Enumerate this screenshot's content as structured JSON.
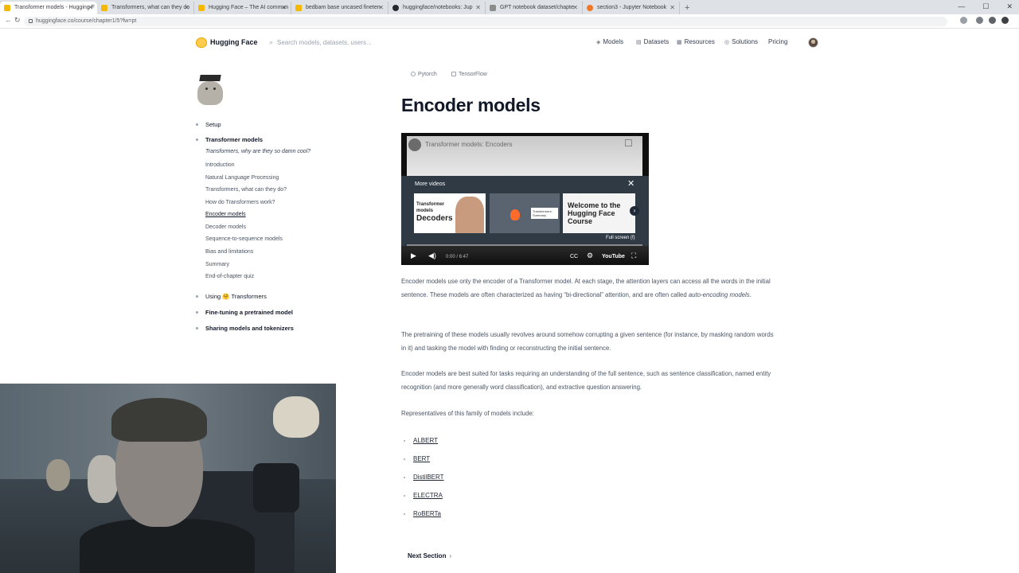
{
  "browser": {
    "tabs": [
      {
        "label": "Transformer models - Hugging F",
        "active": true
      },
      {
        "label": "Transformers, what can they do"
      },
      {
        "label": "Hugging Face – The AI commun"
      },
      {
        "label": "bedbam base uncased fineten"
      },
      {
        "label": "huggingface/notebooks: Jup"
      },
      {
        "label": "GPT notebook dataset/chapte"
      },
      {
        "label": "section3 - Jupyter Notebook"
      }
    ],
    "new_tab": "+",
    "url": "huggingface.co/course/chapter1/5?fw=pt"
  },
  "header": {
    "brand": "Hugging Face",
    "search_placeholder": "Search models, datasets, users...",
    "nav": [
      "Models",
      "Datasets",
      "Resources",
      "Solutions",
      "Pricing"
    ]
  },
  "sidebar": {
    "sections": [
      {
        "label": "Setup"
      },
      {
        "label": "Transformer models"
      },
      {
        "label": "Using 🤗 Transformers"
      },
      {
        "label": "Fine-tuning a pretrained model"
      },
      {
        "label": "Sharing models and tokenizers"
      }
    ],
    "items": [
      "Transformers, why are they so damn cool?",
      "Introduction",
      "Natural Language Processing",
      "Transformers, what can they do?",
      "How do Transformers work?",
      "Encoder models",
      "Decoder models",
      "Sequence-to-sequence models",
      "Bias and limitations",
      "Summary",
      "End-of-chapter quiz"
    ]
  },
  "main": {
    "framework_tabs": [
      "Pytorch",
      "TensorFlow"
    ],
    "title": "Encoder models",
    "video": {
      "title": "Transformer models: Encoders",
      "more_videos": "More videos",
      "thumb1_small": "Transformer models",
      "thumb1_big": "Decoders",
      "thumb2_card": "Transformers: Summary",
      "thumb3_line1": "Welcome to the",
      "thumb3_line2": "Hugging Face",
      "thumb3_line3": "Course",
      "fullscreen_tip": "Full screen (f)",
      "time": "0:00 / 6:47",
      "youtube": "YouTube"
    },
    "para1_a": "Encoder models use only the encoder of a Transformer model. At each stage, the attention layers can access all the words in the initial sentence. These models are often characterized as having “bi-directional” attention, and are often called ",
    "para1_em": "auto-encoding models",
    "para1_b": ".",
    "para2": "The pretraining of these models usually revolves around somehow corrupting a given sentence (for instance, by masking random words in it) and tasking the model with finding or reconstructing the initial sentence.",
    "para3": "Encoder models are best suited for tasks requiring an understanding of the full sentence, such as sentence classification, named entity recognition (and more generally word classification), and extractive question answering.",
    "para4": "Representatives of this family of models include:",
    "models": [
      "ALBERT",
      "BERT",
      "DistilBERT",
      "ELECTRA",
      "RoBERTa"
    ],
    "next_section": "Next Section",
    "next_arrow": "›"
  }
}
